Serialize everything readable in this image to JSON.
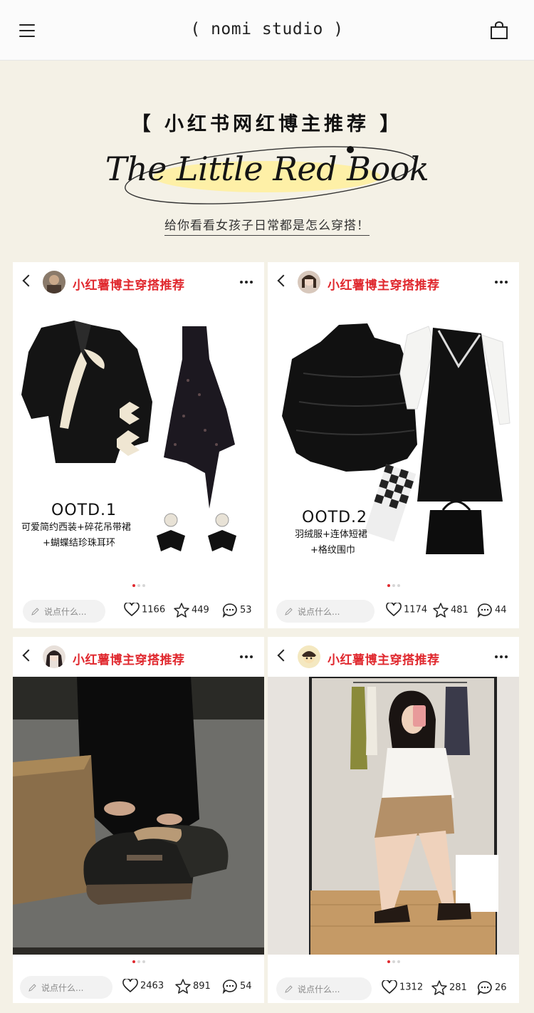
{
  "header": {
    "brand": "( nomi studio )"
  },
  "hero": {
    "title_cn": "【 小红书网红博主推荐 】",
    "title_en": "The Little Red Book",
    "subtitle": "给你看看女孩子日常都是怎么穿搭！"
  },
  "cards": [
    {
      "title": "小红薯博主穿搭推荐",
      "ootd": "OOTD.1",
      "caption_1": "可爱简约西装+碎花吊带裙",
      "caption_2": "+蝴蝶结珍珠耳环",
      "comment_placeholder": "说点什么...",
      "likes": "1166",
      "favorites": "449",
      "comments": "53"
    },
    {
      "title": "小红薯博主穿搭推荐",
      "ootd": "OOTD.2",
      "caption_1": "羽绒服+连体短裙",
      "caption_2": "+格纹围巾",
      "comment_placeholder": "说点什么...",
      "likes": "1174",
      "favorites": "481",
      "comments": "44"
    },
    {
      "title": "小红薯博主穿搭推荐",
      "comment_placeholder": "说点什么...",
      "likes": "2463",
      "favorites": "891",
      "comments": "54"
    },
    {
      "title": "小红薯博主穿搭推荐",
      "comment_placeholder": "说点什么...",
      "likes": "1312",
      "favorites": "281",
      "comments": "26"
    }
  ],
  "colors": {
    "accent_red": "#e0282e",
    "page_bg": "#f4f1e6"
  },
  "icons": [
    "menu-icon",
    "shopping-bag-icon",
    "back-icon",
    "more-icon",
    "pencil-icon",
    "heart-icon",
    "star-icon",
    "comment-icon"
  ]
}
